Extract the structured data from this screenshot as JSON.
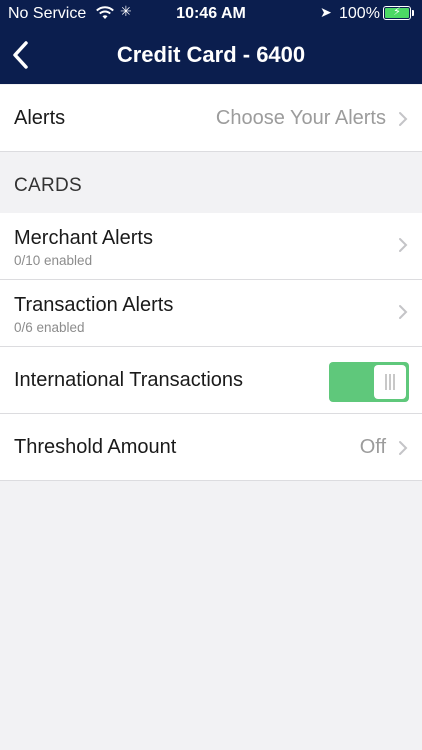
{
  "status_bar": {
    "carrier": "No Service",
    "time": "10:46 AM",
    "battery": "100%"
  },
  "nav": {
    "title": "Credit Card - 6400"
  },
  "alerts_row": {
    "label": "Alerts",
    "value": "Choose Your Alerts"
  },
  "section": {
    "title": "CARDS"
  },
  "rows": [
    {
      "label": "Merchant Alerts",
      "sub": "0/10 enabled"
    },
    {
      "label": "Transaction Alerts",
      "sub": "0/6 enabled"
    },
    {
      "label": "International Transactions",
      "toggle_on": true
    },
    {
      "label": "Threshold Amount",
      "value": "Off"
    }
  ],
  "colors": {
    "nav_bg": "#0b1e4e",
    "toggle_on": "#5fc87b",
    "page_bg": "#f2f2f4"
  }
}
